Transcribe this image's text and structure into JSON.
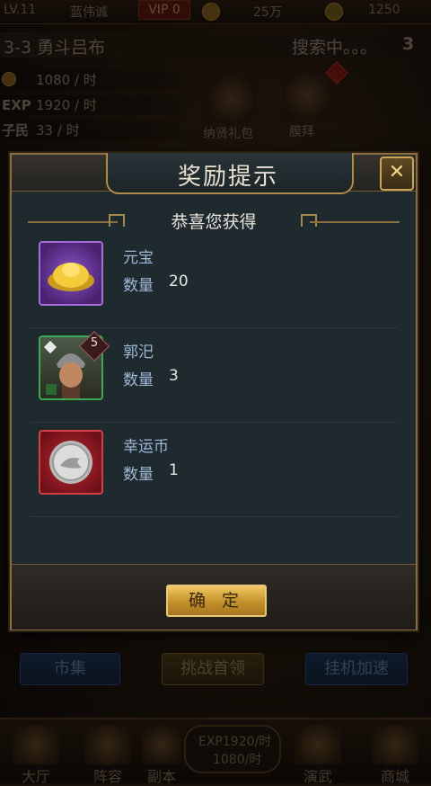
{
  "topbar": {
    "level": "LV.11",
    "player": "蓝伟诚",
    "vip": "VIP 0",
    "coins": "25万",
    "gold": "1250"
  },
  "stage": {
    "name": "3-3 勇斗吕布",
    "search": "搜索中。。。",
    "search_count": "3"
  },
  "stats": {
    "money_rate": "1080 / 时",
    "exp_label": "EXP",
    "exp_rate": "1920 / 时",
    "people_label": "子民",
    "people": "33 / 时"
  },
  "top_icons": {
    "gift": "纳贤礼包",
    "worship": "膜拜"
  },
  "side_buttons": {
    "market": "市集",
    "challenge": "挑战首领",
    "idle": "挂机加速"
  },
  "bottom_nav": {
    "hall": "大厅",
    "formation": "阵容",
    "dungeon": "副本",
    "center_exp": "EXP1920/时",
    "center_money": "1080/时",
    "duel": "演武",
    "shop": "商城"
  },
  "dialog": {
    "title": "奖励提示",
    "subtitle": "恭喜您获得",
    "qty_label": "数量",
    "confirm": "确 定",
    "rewards": [
      {
        "name": "元宝",
        "qty": "20",
        "icon": "gold-ingot-icon",
        "frame_color": "#7a3fb0"
      },
      {
        "name": "郭汜",
        "qty": "3",
        "icon": "general-portrait-icon",
        "frame_color": "#2f8a3a",
        "star": "5"
      },
      {
        "name": "幸运币",
        "qty": "1",
        "icon": "lucky-coin-icon",
        "frame_color": "#a02028"
      }
    ]
  }
}
